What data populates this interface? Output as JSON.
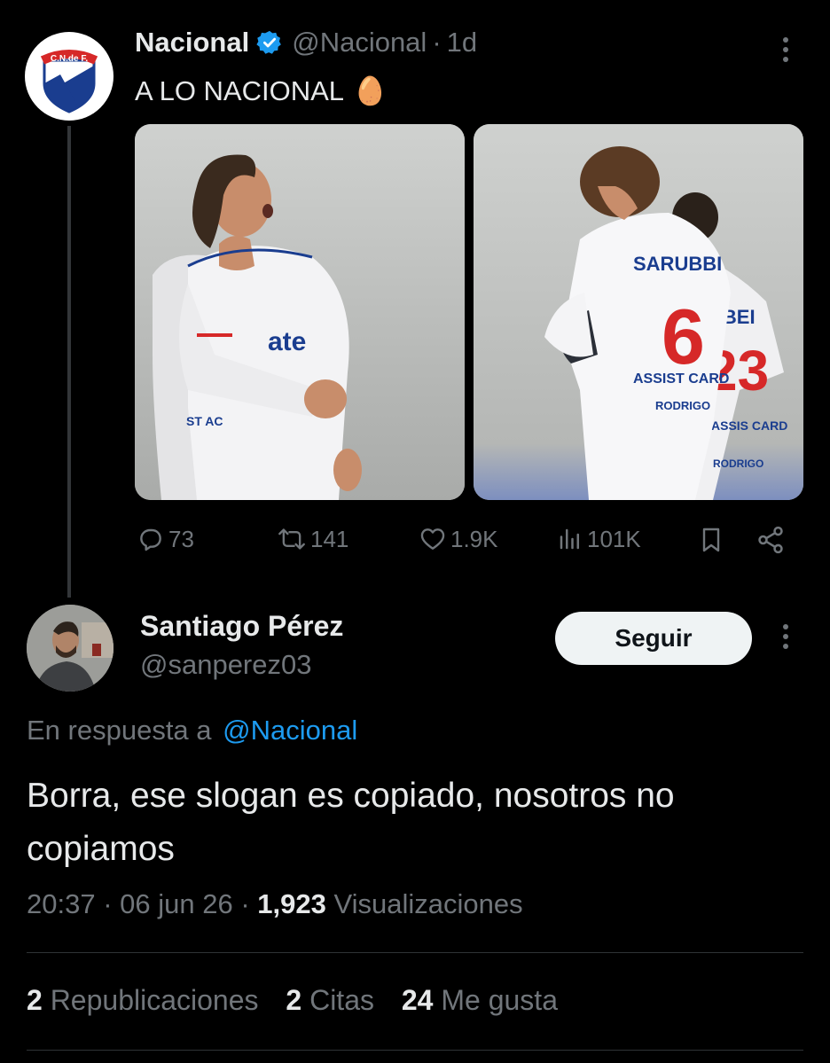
{
  "original_tweet": {
    "author_name": "Nacional",
    "handle": "@Nacional",
    "separator": "·",
    "time": "1d",
    "text": "A LO NACIONAL",
    "emoji": "🥚",
    "avatar_text": "C.N.de F.",
    "image_left_text": "ate",
    "image_left_chest_text": "ST AC",
    "image_right_name": "SARUBBI",
    "image_right_number": "6",
    "image_right_sponsor": "ASSIST CARD",
    "image_right_sponsor_line2": "RODRIGO",
    "image_right_back_name": "UBEI",
    "image_right_back_number": "23",
    "image_right_back_sponsor": "ASSIS CARD",
    "image_right_back_name2": "RODRIGO",
    "actions": {
      "replies": "73",
      "reposts": "141",
      "likes": "1.9K",
      "views": "101K"
    }
  },
  "reply_tweet": {
    "author_name": "Santiago Pérez",
    "handle": "@sanperez03",
    "follow_label": "Seguir",
    "reply_prefix": "En respuesta a",
    "reply_to": "@Nacional",
    "text": "Borra, ese slogan es copiado, nosotros no copiamos",
    "time": "20:37",
    "date": "06 jun 26",
    "views_count": "1,923",
    "views_label": "Visualizaciones"
  },
  "stats": {
    "reposts_count": "2",
    "reposts_label": "Republicaciones",
    "quotes_count": "2",
    "quotes_label": "Citas",
    "likes_count": "24",
    "likes_label": "Me gusta"
  },
  "colors": {
    "background": "#000000",
    "text_primary": "#e7e9ea",
    "text_secondary": "#71767b",
    "link": "#1d9bf0",
    "verified": "#1d9bf0",
    "nacional_blue": "#1a3d8f",
    "nacional_red": "#d62828"
  }
}
